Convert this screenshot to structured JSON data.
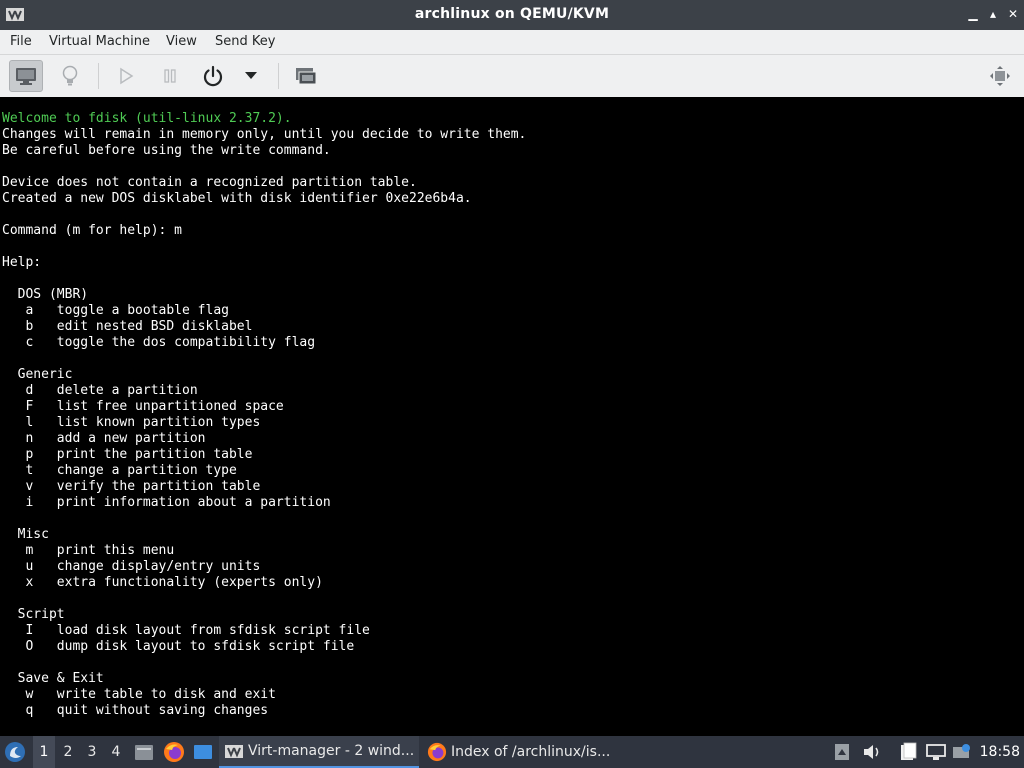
{
  "window": {
    "title": "archlinux on QEMU/KVM",
    "controls": {
      "minimize": "▁",
      "maximize": "▴",
      "close": "✕"
    }
  },
  "menubar": {
    "file": "File",
    "virtual_machine": "Virtual Machine",
    "view": "View",
    "send_key": "Send Key"
  },
  "toolbar": {
    "buttons": [
      "console-view",
      "details-view",
      "run",
      "pause",
      "shutdown",
      "shutdown-menu",
      "snapshots",
      "fullscreen"
    ]
  },
  "console": {
    "welcome": "Welcome to fdisk (util-linux 2.37.2).",
    "body": "Changes will remain in memory only, until you decide to write them.\nBe careful before using the write command.\n\nDevice does not contain a recognized partition table.\nCreated a new DOS disklabel with disk identifier 0xe22e6b4a.\n\nCommand (m for help): m\n\nHelp:\n\n  DOS (MBR)\n   a   toggle a bootable flag\n   b   edit nested BSD disklabel\n   c   toggle the dos compatibility flag\n\n  Generic\n   d   delete a partition\n   F   list free unpartitioned space\n   l   list known partition types\n   n   add a new partition\n   p   print the partition table\n   t   change a partition type\n   v   verify the partition table\n   i   print information about a partition\n\n  Misc\n   m   print this menu\n   u   change display/entry units\n   x   extra functionality (experts only)\n\n  Script\n   I   load disk layout from sfdisk script file\n   O   dump disk layout to sfdisk script file\n\n  Save & Exit\n   w   write table to disk and exit\n   q   quit without saving changes"
  },
  "taskbar": {
    "workspaces": [
      "1",
      "2",
      "3",
      "4"
    ],
    "active_workspace": "1",
    "tasks": [
      {
        "label": "Virt-manager - 2 wind...",
        "icon": "virt-manager-icon",
        "active": true
      },
      {
        "label": "Index of /archlinux/is...",
        "icon": "firefox-icon",
        "active": false
      }
    ],
    "clock": "18:58"
  },
  "colors": {
    "titlebar": "#3c4148",
    "chrome": "#eff0f1",
    "console_bg": "#000000",
    "console_text": "#c8c8c8",
    "console_green": "#4fcb54",
    "taskbar": "#2f343f",
    "accent": "#5294e2"
  }
}
